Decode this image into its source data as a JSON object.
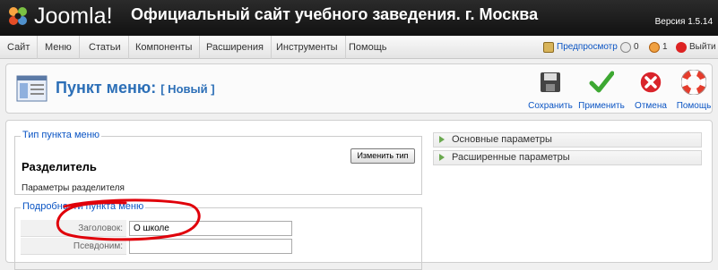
{
  "header": {
    "logo_text": "Joomla!",
    "site_title": "Официальный сайт учебного заведения. г. Москва",
    "version": "Версия 1.5.14"
  },
  "menubar": {
    "items": [
      "Сайт",
      "Меню",
      "Статьи",
      "Компоненты",
      "Расширения",
      "Инструменты",
      "Помощь"
    ],
    "preview": "Предпросмотр",
    "messages": "0",
    "users": "1",
    "logout": "Выйти"
  },
  "toolbar": {
    "title": "Пункт меню:",
    "subtitle": "[ Новый ]",
    "buttons": {
      "save": "Сохранить",
      "apply": "Применить",
      "cancel": "Отмена",
      "help": "Помощь"
    }
  },
  "menu_type": {
    "legend": "Тип пункта меню",
    "name": "Разделитель",
    "description": "Параметры разделителя",
    "change_button": "Изменить тип"
  },
  "details": {
    "legend": "Подробности пункта меню",
    "fields": [
      {
        "label": "Заголовок:",
        "value": "О школе"
      },
      {
        "label": "Псевдоним:",
        "value": ""
      }
    ]
  },
  "params": {
    "basic": "Основные параметры",
    "advanced": "Расширенные параметры"
  },
  "colors": {
    "accent": "#2c6fb7",
    "link": "#0b55c4",
    "annotation": "#e0000a"
  }
}
